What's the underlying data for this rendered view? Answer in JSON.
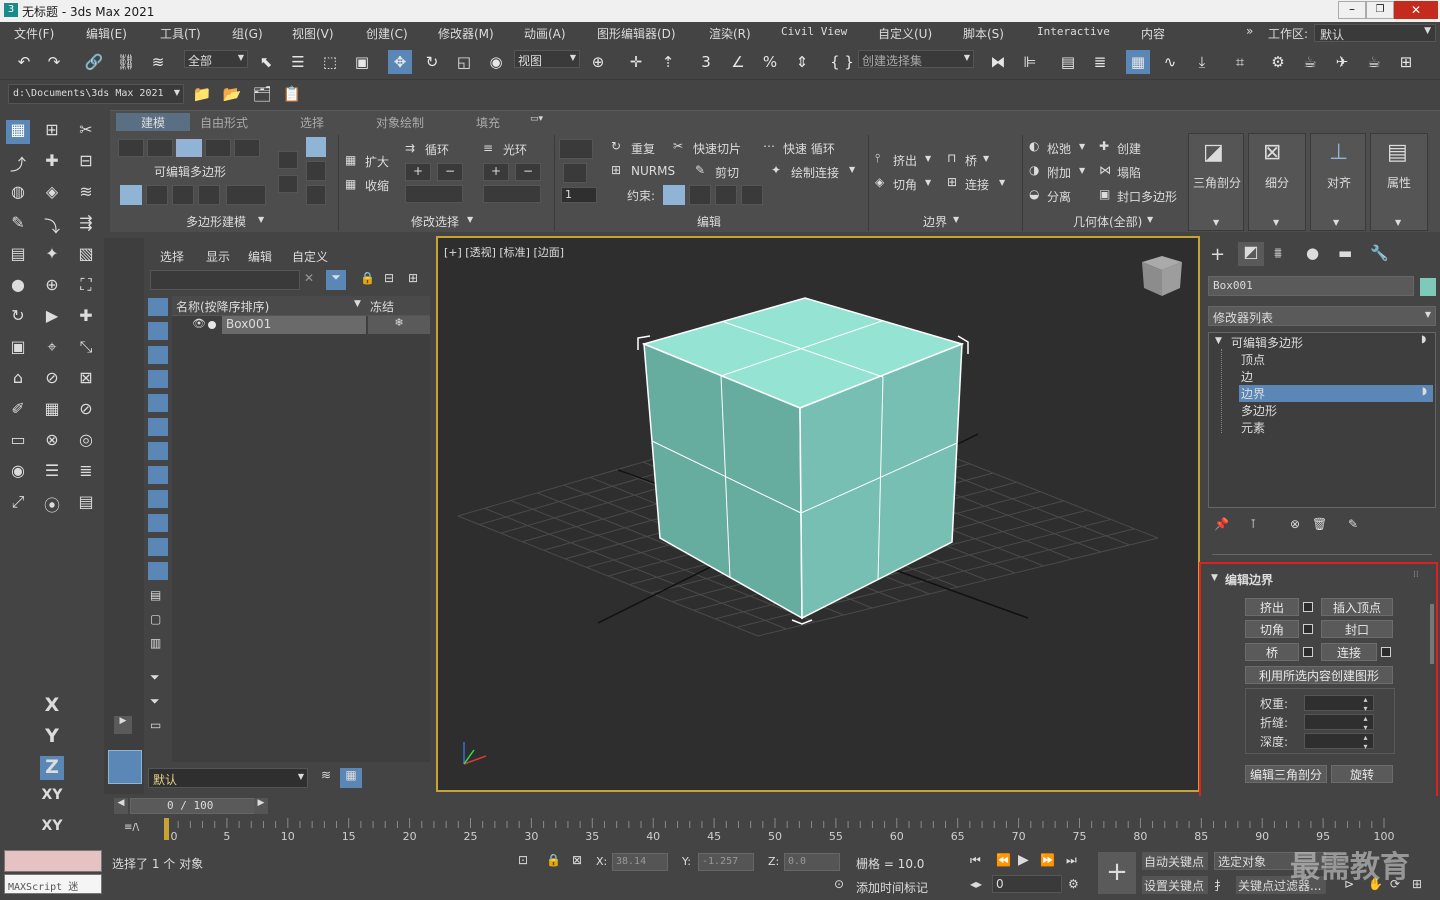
{
  "window": {
    "title": "无标题 - 3ds Max 2021",
    "title_icon": "3ds-max-logo-icon"
  },
  "menu": [
    "文件(F)",
    "编辑(E)",
    "工具(T)",
    "组(G)",
    "视图(V)",
    "创建(C)",
    "修改器(M)",
    "动画(A)",
    "图形编辑器(D)",
    "渲染(R)",
    "Civil View",
    "自定义(U)",
    "脚本(S)",
    "Interactive",
    "内容"
  ],
  "workspace": {
    "label": "工作区:",
    "value": "默认"
  },
  "toolbar": {
    "filter": "全部",
    "ref_coord": "视图",
    "selection_set": "创建选择集"
  },
  "path_dropdown": "d:\\Documents\\3ds Max 2021",
  "ribbon": {
    "tabs": [
      "建模",
      "自由形式",
      "选择",
      "对象绘制",
      "填充"
    ],
    "active_tab": "建模",
    "poly_label": "可编辑多边形",
    "groups": [
      "多边形建模",
      "修改选择",
      "编辑",
      "边界",
      "几何体(全部)"
    ],
    "modify_sel": {
      "grow": "扩大",
      "shrink": "收缩",
      "loop": "循环",
      "ring": "光环"
    },
    "edit": {
      "repeat": "重复",
      "quickslice": "快速切片",
      "swiftloop": "快速 循环",
      "nurms": "NURMS",
      "cut": "剪切",
      "paintconnect": "绘制连接",
      "constraint": "约束:",
      "spin_value": "1"
    },
    "border": {
      "extrude": "挤出",
      "bridge": "桥",
      "chamfer": "切角",
      "connect": "连接"
    },
    "geometry": {
      "relax": "松弛",
      "create": "创建",
      "attach": "附加",
      "collapse": "塌陷",
      "detach": "分离",
      "cap": "封口多边形"
    },
    "big_buttons": [
      "三角剖分",
      "细分",
      "对齐",
      "属性"
    ]
  },
  "scene_explorer": {
    "menu": [
      "选择",
      "显示",
      "编辑",
      "自定义"
    ],
    "col_name": "名称(按降序排序)",
    "col_freeze": "冻结",
    "rows": [
      {
        "name": "Box001"
      }
    ],
    "layer_value": "默认"
  },
  "viewport": {
    "label": "[+] [透视] [标准] [边面]",
    "accent": "#c8a232",
    "box_color": "#7ec9b8"
  },
  "command_panel": {
    "object_name": "Box001",
    "modifier_list": "修改器列表",
    "stack": {
      "root": "可编辑多边形",
      "items": [
        "顶点",
        "边",
        "边界",
        "多边形",
        "元素"
      ],
      "selected": "边界"
    },
    "rollout": {
      "title": "编辑边界",
      "extrude": "挤出",
      "insert_vertex": "插入顶点",
      "chamfer": "切角",
      "cap": "封口",
      "bridge": "桥",
      "connect": "连接",
      "create_shape": "利用所选内容创建图形",
      "weight": "权重:",
      "crease": "折缝:",
      "depth": "深度:",
      "edit_tri": "编辑三角剖分",
      "turn": "旋转"
    },
    "highlight_color": "#e02020"
  },
  "timeline": {
    "slider": "0 / 100",
    "ticks": [
      "0",
      "5",
      "10",
      "15",
      "20",
      "25",
      "30",
      "35",
      "40",
      "45",
      "50",
      "55",
      "60",
      "65",
      "70",
      "75",
      "80",
      "85",
      "90",
      "95",
      "100"
    ]
  },
  "status": {
    "maxscript": "MAXScript 迷",
    "selection": "选择了 1 个 对象",
    "x_label": "X:",
    "x": "38.14",
    "y_label": "Y:",
    "y": "-1.257",
    "z_label": "Z:",
    "z": "0.0",
    "grid": "栅格 = 10.0",
    "add_time_tag": "添加时间标记",
    "auto_key": "自动关键点",
    "set_key": "设置关键点",
    "selected_object": "选定对象",
    "key_filters": "关键点过滤器...",
    "frame": "0",
    "watermark": "最需教育"
  },
  "left_toolbar_axes": [
    "X",
    "Y",
    "Z",
    "XY",
    "XY"
  ]
}
